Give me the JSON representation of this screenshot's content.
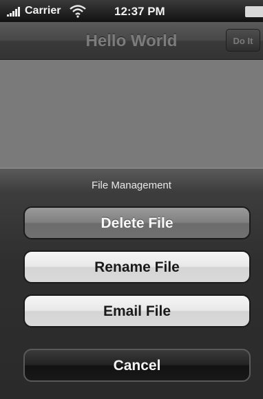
{
  "status_bar": {
    "carrier": "Carrier",
    "time": "12:37 PM",
    "signal_icon": "signal-bars-icon",
    "wifi_icon": "wifi-icon",
    "battery_icon": "battery-icon"
  },
  "nav_bar": {
    "title": "Hello World",
    "right_button_label": "Do It"
  },
  "action_sheet": {
    "title": "File Management",
    "buttons": [
      {
        "label": "Delete File"
      },
      {
        "label": "Rename File"
      },
      {
        "label": "Email File"
      }
    ],
    "cancel_label": "Cancel"
  }
}
